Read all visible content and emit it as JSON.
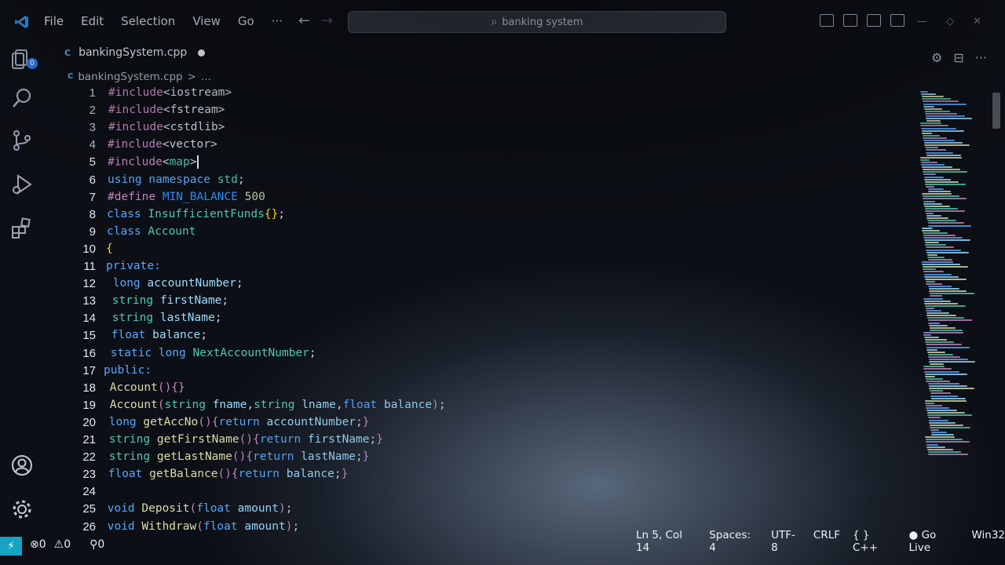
{
  "menu": [
    "File",
    "Edit",
    "Selection",
    "View",
    "Go",
    "···"
  ],
  "search": {
    "text": "banking system"
  },
  "tab": {
    "filename": "bankingSystem.cpp"
  },
  "breadcrumb": {
    "file": "bankingSystem.cpp",
    "sep": ">",
    "rest": "..."
  },
  "activity": {
    "explorer_badge": "0"
  },
  "code_lines": [
    {
      "n": "1",
      "parts": [
        [
          "pp",
          "#include"
        ],
        [
          "pl",
          "<iostream>"
        ]
      ]
    },
    {
      "n": "2",
      "parts": [
        [
          "pp",
          "#include"
        ],
        [
          "pl",
          "<fstream>"
        ]
      ]
    },
    {
      "n": "3",
      "parts": [
        [
          "pp",
          "#include"
        ],
        [
          "pl",
          "<cstdlib>"
        ]
      ]
    },
    {
      "n": "4",
      "parts": [
        [
          "pp",
          "#include"
        ],
        [
          "pl",
          "<vector>"
        ]
      ]
    },
    {
      "n": "5",
      "parts": [
        [
          "pp",
          "#include"
        ],
        [
          "pl",
          "<"
        ],
        [
          "ty",
          "map"
        ],
        [
          "pl",
          ">"
        ]
      ],
      "cursor": true
    },
    {
      "n": "6",
      "parts": [
        [
          "kw",
          "using "
        ],
        [
          "kw",
          "namespace "
        ],
        [
          "ty",
          "std"
        ],
        [
          "pl",
          ";"
        ]
      ]
    },
    {
      "n": "7",
      "parts": [
        [
          "pp",
          "#define "
        ],
        [
          "mc",
          "MIN_BALANCE "
        ],
        [
          "num",
          "500"
        ]
      ]
    },
    {
      "n": "8",
      "parts": [
        [
          "kw",
          "class "
        ],
        [
          "ty",
          "InsufficientFunds"
        ],
        [
          "br",
          "{}"
        ],
        [
          "pl",
          ";"
        ]
      ]
    },
    {
      "n": "9",
      "parts": [
        [
          "kw",
          "class "
        ],
        [
          "ty",
          "Account"
        ]
      ]
    },
    {
      "n": "10",
      "parts": [
        [
          "br",
          "{"
        ]
      ]
    },
    {
      "n": "11",
      "parts": [
        [
          "kw",
          "private:"
        ]
      ]
    },
    {
      "n": "12",
      "parts": [
        [
          "pl",
          " "
        ],
        [
          "kw",
          "long "
        ],
        [
          "vr",
          "accountNumber"
        ],
        [
          "pl",
          ";"
        ]
      ]
    },
    {
      "n": "13",
      "parts": [
        [
          "pl",
          " "
        ],
        [
          "ty",
          "string "
        ],
        [
          "vr",
          "firstName"
        ],
        [
          "pl",
          ";"
        ]
      ]
    },
    {
      "n": "14",
      "parts": [
        [
          "pl",
          " "
        ],
        [
          "ty",
          "string "
        ],
        [
          "vr",
          "lastName"
        ],
        [
          "pl",
          ";"
        ]
      ]
    },
    {
      "n": "15",
      "parts": [
        [
          "pl",
          " "
        ],
        [
          "kw",
          "float "
        ],
        [
          "vr",
          "balance"
        ],
        [
          "pl",
          ";"
        ]
      ]
    },
    {
      "n": "16",
      "parts": [
        [
          "pl",
          " "
        ],
        [
          "kw",
          "static "
        ],
        [
          "kw",
          "long "
        ],
        [
          "ty",
          "NextAccountNumber"
        ],
        [
          "pl",
          ";"
        ]
      ]
    },
    {
      "n": "17",
      "parts": [
        [
          "kw",
          "public:"
        ]
      ]
    },
    {
      "n": "18",
      "parts": [
        [
          "pl",
          " "
        ],
        [
          "fn",
          "Account"
        ],
        [
          "pp",
          "(){}"
        ]
      ]
    },
    {
      "n": "19",
      "parts": [
        [
          "pl",
          " "
        ],
        [
          "fn",
          "Account"
        ],
        [
          "pp",
          "("
        ],
        [
          "ty",
          "string "
        ],
        [
          "vr",
          "fname"
        ],
        [
          "pl",
          ","
        ],
        [
          "ty",
          "string "
        ],
        [
          "vr",
          "lname"
        ],
        [
          "pl",
          ","
        ],
        [
          "kw",
          "float "
        ],
        [
          "vr",
          "balance"
        ],
        [
          "pp",
          ")"
        ],
        [
          "pl",
          ";"
        ]
      ]
    },
    {
      "n": "20",
      "parts": [
        [
          "pl",
          " "
        ],
        [
          "kw",
          "long "
        ],
        [
          "fn",
          "getAccNo"
        ],
        [
          "pp",
          "(){"
        ],
        [
          "kw",
          "return "
        ],
        [
          "vr",
          "accountNumber"
        ],
        [
          "pl",
          ";"
        ],
        [
          "pp",
          "}"
        ]
      ]
    },
    {
      "n": "21",
      "parts": [
        [
          "pl",
          " "
        ],
        [
          "ty",
          "string "
        ],
        [
          "fn",
          "getFirstName"
        ],
        [
          "pp",
          "(){"
        ],
        [
          "kw",
          "return "
        ],
        [
          "vr",
          "firstName"
        ],
        [
          "pl",
          ";"
        ],
        [
          "pp",
          "}"
        ]
      ]
    },
    {
      "n": "22",
      "parts": [
        [
          "pl",
          " "
        ],
        [
          "ty",
          "string "
        ],
        [
          "fn",
          "getLastName"
        ],
        [
          "pp",
          "(){"
        ],
        [
          "kw",
          "return "
        ],
        [
          "vr",
          "lastName"
        ],
        [
          "pl",
          ";"
        ],
        [
          "pp",
          "}"
        ]
      ]
    },
    {
      "n": "23",
      "parts": [
        [
          "pl",
          " "
        ],
        [
          "kw",
          "float "
        ],
        [
          "fn",
          "getBalance"
        ],
        [
          "pp",
          "(){"
        ],
        [
          "kw",
          "return "
        ],
        [
          "vr",
          "balance"
        ],
        [
          "pl",
          ";"
        ],
        [
          "pp",
          "}"
        ]
      ]
    },
    {
      "n": "24",
      "parts": []
    },
    {
      "n": "25",
      "parts": [
        [
          "pl",
          " "
        ],
        [
          "kw",
          "void "
        ],
        [
          "fn",
          "Deposit"
        ],
        [
          "pp",
          "("
        ],
        [
          "kw",
          "float "
        ],
        [
          "vr",
          "amount"
        ],
        [
          "pp",
          ")"
        ],
        [
          "pl",
          ";"
        ]
      ]
    },
    {
      "n": "26",
      "parts": [
        [
          "pl",
          " "
        ],
        [
          "kw",
          "void "
        ],
        [
          "fn",
          "Withdraw"
        ],
        [
          "pp",
          "("
        ],
        [
          "kw",
          "float "
        ],
        [
          "vr",
          "amount"
        ],
        [
          "pp",
          ")"
        ],
        [
          "pl",
          ";"
        ]
      ]
    }
  ],
  "status": {
    "remote_icon": "remote-icon",
    "errors": "0",
    "warnings": "0",
    "ports": "0",
    "position": "Ln 5, Col 14",
    "spaces": "Spaces: 4",
    "encoding": "UTF-8",
    "eol": "CRLF",
    "language": "C++",
    "braces": "{ }",
    "golive": "Go Live",
    "platform": "Win32"
  },
  "colors": {
    "keyword": "#58a6ff",
    "preprocessor": "#c586c0",
    "type": "#4ec9b0",
    "function": "#dcdcaa",
    "variable": "#9cdcfe",
    "macro": "#2b8cff",
    "number": "#b5cea8",
    "bracket": "#ffd700",
    "remote_bg": "#16a3c4"
  }
}
